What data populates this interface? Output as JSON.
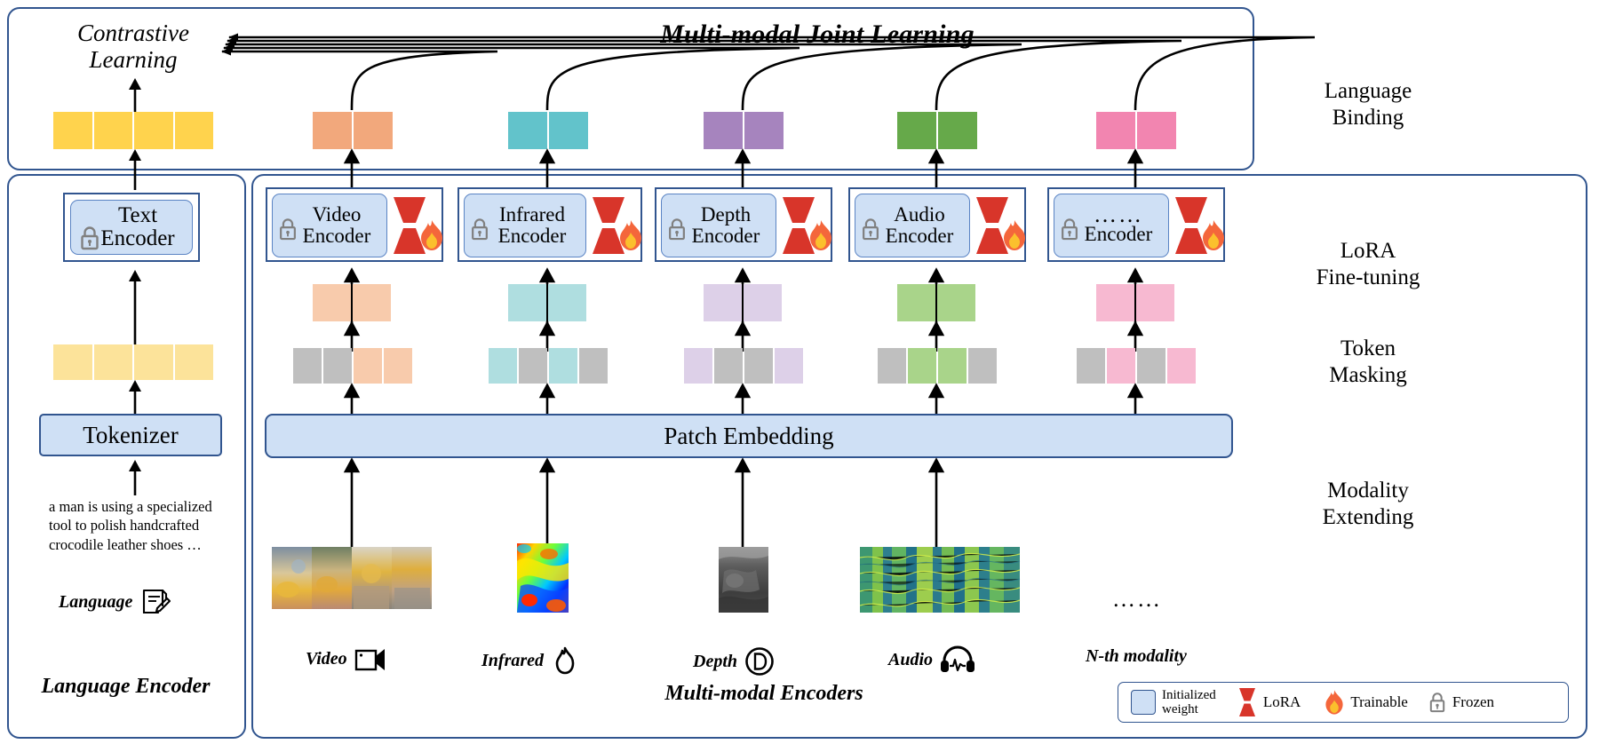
{
  "title": "Multi-modal Joint Learning",
  "contrastive": {
    "line1": "Contrastive",
    "line2": "Learning"
  },
  "side_labels": {
    "language_binding": {
      "line1": "Language",
      "line2": "Binding"
    },
    "lora": {
      "line1": "LoRA",
      "line2": "Fine-tuning"
    },
    "token_masking": {
      "line1": "Token",
      "line2": "Masking"
    },
    "modality_extending": {
      "line1": "Modality",
      "line2": "Extending"
    }
  },
  "language_encoder": {
    "section_label": "Language Encoder",
    "encoder_line1": "Text",
    "encoder_line2": "Encoder",
    "tokenizer": "Tokenizer",
    "caption": "a man is using a specialized tool to polish handcrafted crocodile leather shoes …",
    "modality_label": "Language",
    "modality_icon": "document-pencil-icon",
    "embedding_color": "#FFD34D",
    "token_color": "#FCE39A"
  },
  "multimodal": {
    "section_label": "Multi-modal Encoders",
    "patch_embedding": "Patch Embedding",
    "nth_modality_label": "N-th modality",
    "ellipsis": "……",
    "branches": [
      {
        "id": "video",
        "encoder_line1": "Video",
        "encoder_line2": "Encoder",
        "modality_label": "Video",
        "modality_icon": "video-camera-icon",
        "binding_color": "#F2A87C",
        "token_color": "#F8CBAC",
        "mask_pattern": [
          "gray",
          "gray",
          "color",
          "color"
        ],
        "thumb": "video-frames-thumbnail"
      },
      {
        "id": "infrared",
        "encoder_line1": "Infrared",
        "encoder_line2": "Encoder",
        "modality_label": "Infrared",
        "modality_icon": "flame-outline-icon",
        "binding_color": "#62C3CB",
        "token_color": "#AFDEE0",
        "mask_pattern": [
          "color",
          "gray",
          "color",
          "gray"
        ],
        "thumb": "infrared-heatmap-thumbnail"
      },
      {
        "id": "depth",
        "encoder_line1": "Depth",
        "encoder_line2": "Encoder",
        "modality_label": "Depth",
        "modality_icon": "letter-d-circle-icon",
        "binding_color": "#A684BE",
        "token_color": "#DDD0E8",
        "mask_pattern": [
          "color",
          "gray",
          "gray",
          "color"
        ],
        "thumb": "depth-map-thumbnail"
      },
      {
        "id": "audio",
        "encoder_line1": "Audio",
        "encoder_line2": "Encoder",
        "modality_label": "Audio",
        "modality_icon": "headphones-waveform-icon",
        "binding_color": "#66A94A",
        "token_color": "#A9D48A",
        "mask_pattern": [
          "gray",
          "color",
          "color",
          "gray"
        ],
        "thumb": "audio-spectrogram-thumbnail"
      },
      {
        "id": "nth",
        "encoder_line1": "……",
        "encoder_line2": "Encoder",
        "modality_label": "N-th modality",
        "modality_icon": "none",
        "binding_color": "#F285B0",
        "token_color": "#F7B9D1",
        "mask_pattern": [
          "gray",
          "color",
          "gray",
          "color"
        ],
        "thumb": "none"
      }
    ]
  },
  "legend": {
    "items": [
      {
        "icon": "initialized-weight-swatch",
        "label_line1": "Initialized",
        "label_line2": "weight"
      },
      {
        "icon": "lora-icon",
        "label_line1": "LoRA",
        "label_line2": ""
      },
      {
        "icon": "flame-icon",
        "label_line1": "Trainable",
        "label_line2": ""
      },
      {
        "icon": "lock-icon",
        "label_line1": "Frozen",
        "label_line2": ""
      }
    ]
  },
  "colors": {
    "panel_border": "#31558f",
    "box_fill": "#cfe0f5",
    "mask_gray": "#BFBFBF",
    "lora_red": "#D8352A",
    "lock_gray": "#808080"
  }
}
